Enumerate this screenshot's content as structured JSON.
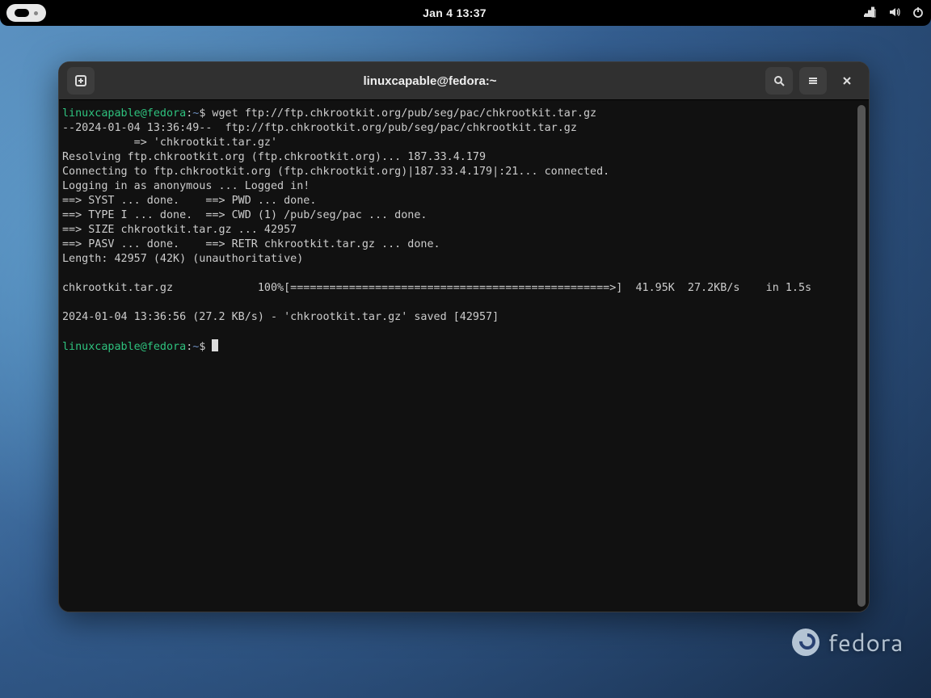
{
  "topbar": {
    "datetime": "Jan 4  13:37"
  },
  "terminal": {
    "title": "linuxcapable@fedora:~",
    "prompt_user": "linuxcapable@fedora",
    "prompt_sep": ":",
    "prompt_path": "~",
    "prompt_sigil": "$",
    "command": " wget ftp://ftp.chkrootkit.org/pub/seg/pac/chkrootkit.tar.gz",
    "output_lines": [
      "--2024-01-04 13:36:49--  ftp://ftp.chkrootkit.org/pub/seg/pac/chkrootkit.tar.gz",
      "           => 'chkrootkit.tar.gz'",
      "Resolving ftp.chkrootkit.org (ftp.chkrootkit.org)... 187.33.4.179",
      "Connecting to ftp.chkrootkit.org (ftp.chkrootkit.org)|187.33.4.179|:21... connected.",
      "Logging in as anonymous ... Logged in!",
      "==> SYST ... done.    ==> PWD ... done.",
      "==> TYPE I ... done.  ==> CWD (1) /pub/seg/pac ... done.",
      "==> SIZE chkrootkit.tar.gz ... 42957",
      "==> PASV ... done.    ==> RETR chkrootkit.tar.gz ... done.",
      "Length: 42957 (42K) (unauthoritative)",
      "",
      "chkrootkit.tar.gz             100%[=================================================>]  41.95K  27.2KB/s    in 1.5s",
      "",
      "2024-01-04 13:36:56 (27.2 KB/s) - 'chkrootkit.tar.gz' saved [42957]",
      ""
    ]
  },
  "watermark": {
    "distro": "fedora"
  }
}
